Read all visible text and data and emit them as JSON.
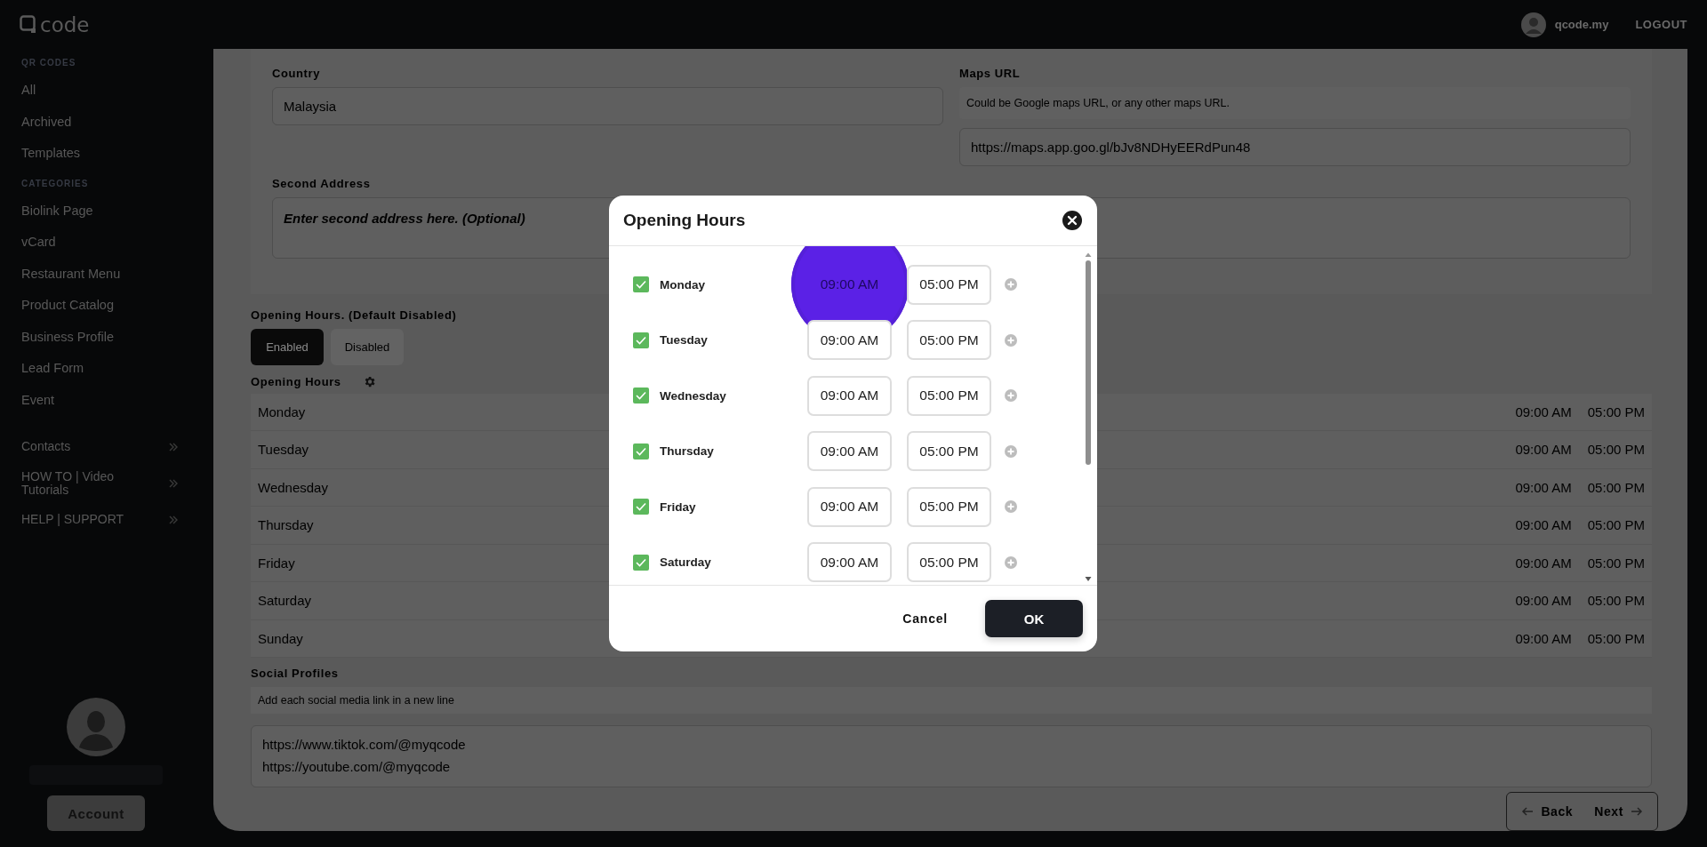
{
  "topbar": {
    "logo": "code",
    "user": "qcode.my",
    "logout": "LOGOUT"
  },
  "sidebar": {
    "sections": [
      {
        "heading": "QR CODES",
        "items": [
          {
            "label": "All"
          },
          {
            "label": "Archived"
          },
          {
            "label": "Templates"
          }
        ]
      },
      {
        "heading": "CATEGORIES",
        "items": [
          {
            "label": "Biolink Page"
          },
          {
            "label": "vCard"
          },
          {
            "label": "Restaurant Menu"
          },
          {
            "label": "Product Catalog"
          },
          {
            "label": "Business Profile"
          },
          {
            "label": "Lead Form"
          },
          {
            "label": "Event"
          }
        ]
      }
    ],
    "links": [
      {
        "label": "Contacts"
      },
      {
        "label": "HOW TO | Video Tutorials"
      },
      {
        "label": "HELP | SUPPORT"
      }
    ],
    "account_button": "Account"
  },
  "form": {
    "country": {
      "label": "Country",
      "value": "Malaysia"
    },
    "maps_url": {
      "label": "Maps URL",
      "hint": "Could be Google maps URL, or any other maps URL.",
      "value": "https://maps.app.goo.gl/bJv8NDHyEERdPun48"
    },
    "second_address": {
      "label": "Second Address",
      "placeholder": "Enter second address here. (Optional)"
    },
    "opening_hours_toggle": {
      "label": "Opening Hours. (Default Disabled)",
      "options": [
        {
          "label": "Enabled",
          "selected": true
        },
        {
          "label": "Disabled",
          "selected": false
        }
      ]
    },
    "hours_list": {
      "title": "Opening Hours",
      "rows": [
        {
          "day": "Monday",
          "open": "09:00 AM",
          "close": "05:00 PM"
        },
        {
          "day": "Tuesday",
          "open": "09:00 AM",
          "close": "05:00 PM"
        },
        {
          "day": "Wednesday",
          "open": "09:00 AM",
          "close": "05:00 PM"
        },
        {
          "day": "Thursday",
          "open": "09:00 AM",
          "close": "05:00 PM"
        },
        {
          "day": "Friday",
          "open": "09:00 AM",
          "close": "05:00 PM"
        },
        {
          "day": "Saturday",
          "open": "09:00 AM",
          "close": "05:00 PM"
        },
        {
          "day": "Sunday",
          "open": "09:00 AM",
          "close": "05:00 PM"
        }
      ]
    },
    "social": {
      "label": "Social Profiles",
      "hint": "Add each social media link in a new line",
      "lines": [
        "https://www.tiktok.com/@myqcode",
        "https://youtube.com/@myqcode"
      ]
    },
    "nav": {
      "back": "Back",
      "next": "Next"
    }
  },
  "modal": {
    "title": "Opening Hours",
    "days": [
      {
        "day": "Monday",
        "checked": true,
        "open": "09:00 AM",
        "close": "05:00 PM",
        "pointer": true
      },
      {
        "day": "Tuesday",
        "checked": true,
        "open": "09:00 AM",
        "close": "05:00 PM",
        "pointer": false
      },
      {
        "day": "Wednesday",
        "checked": true,
        "open": "09:00 AM",
        "close": "05:00 PM",
        "pointer": false
      },
      {
        "day": "Thursday",
        "checked": true,
        "open": "09:00 AM",
        "close": "05:00 PM",
        "pointer": false
      },
      {
        "day": "Friday",
        "checked": true,
        "open": "09:00 AM",
        "close": "05:00 PM",
        "pointer": false
      },
      {
        "day": "Saturday",
        "checked": true,
        "open": "09:00 AM",
        "close": "05:00 PM",
        "pointer": false
      }
    ],
    "cancel": "Cancel",
    "ok": "OK"
  }
}
